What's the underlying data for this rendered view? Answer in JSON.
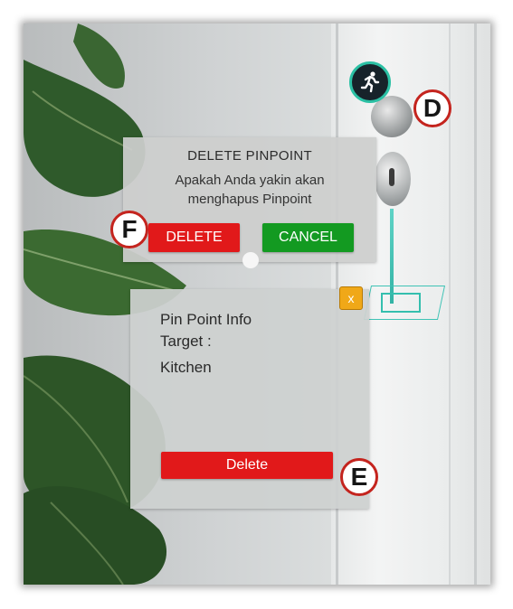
{
  "dialog": {
    "title": "DELETE PINPOINT",
    "message_line1": "Apakah Anda yakin akan",
    "message_line2": "menghapus Pinpoint",
    "delete_label": "DELETE",
    "cancel_label": "CANCEL"
  },
  "info_panel": {
    "title": "Pin Point Info",
    "target_label": "Target :",
    "target_value": "Kitchen",
    "close_label": "x",
    "delete_label": "Delete"
  },
  "markers": {
    "d": "D",
    "e": "E",
    "f": "F"
  },
  "icons": {
    "runner": "running-person-icon"
  },
  "colors": {
    "delete_red": "#e1191a",
    "cancel_green": "#139a21",
    "close_orange": "#f0a818",
    "marker_border": "#c4241e",
    "ar_teal": "#34bfae"
  }
}
